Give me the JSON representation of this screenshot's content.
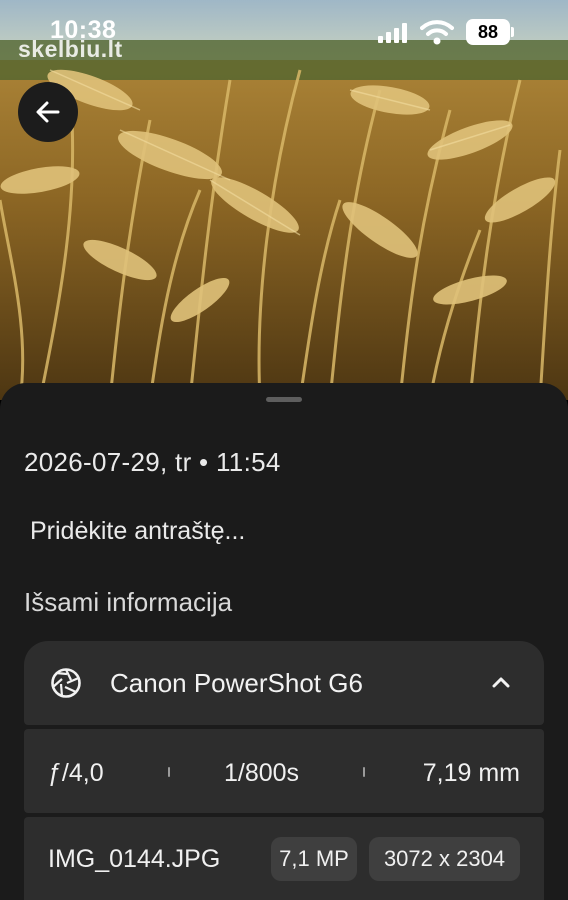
{
  "status_bar": {
    "time": "10:38",
    "battery": "88",
    "watermark": "skelbiu.lt"
  },
  "photo": {
    "subject": "wheat field"
  },
  "details_sheet": {
    "datetime": "2026-07-29, tr • 11:54",
    "caption_placeholder": "Pridėkite antraštę...",
    "section_title": "Išsami informacija",
    "camera": {
      "name": "Canon PowerShot G6",
      "icon": "aperture-icon",
      "aperture": "ƒ/4,0",
      "shutter": "1/800s",
      "focal_length": "7,19 mm"
    },
    "file": {
      "name": "IMG_0144.JPG",
      "megapixels": "7,1 MP",
      "resolution": "3072 x 2304"
    }
  },
  "colors": {
    "sheet_bg": "#1b1b1b",
    "card_bg": "#2d2d2d",
    "chip_bg": "#3f3f3f"
  }
}
